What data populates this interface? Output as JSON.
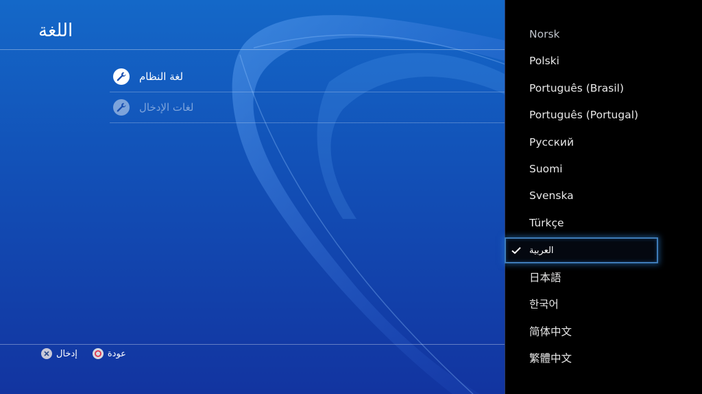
{
  "page": {
    "title": "اللغة"
  },
  "menu": {
    "items": [
      {
        "label": "لغة النظام",
        "enabled": true,
        "icon": "wrench-icon"
      },
      {
        "label": "لغات الإدخال",
        "enabled": false,
        "icon": "wrench-icon"
      }
    ]
  },
  "footer": {
    "enter_label": "إدخال",
    "back_label": "عودة"
  },
  "languages": {
    "items": [
      "Norsk",
      "Polski",
      "Português (Brasil)",
      "Português (Portugal)",
      "Русский",
      "Suomi",
      "Svenska",
      "Türkçe",
      "العربية",
      "日本語",
      "한국어",
      "简体中文",
      "繁體中文"
    ],
    "selected": "العربية"
  },
  "colors": {
    "selection_border": "#3f7cb8",
    "background_top": "#1468c8",
    "background_bottom": "#1234a0"
  }
}
